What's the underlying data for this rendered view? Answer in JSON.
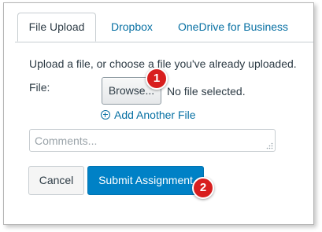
{
  "tabs": [
    {
      "label": "File Upload",
      "active": true
    },
    {
      "label": "Dropbox",
      "active": false
    },
    {
      "label": "OneDrive for Business",
      "active": false
    }
  ],
  "upload": {
    "instructions": "Upload a file, or choose a file you've already uploaded.",
    "file_label": "File:",
    "browse_label": "Browse...",
    "no_file_text": "No file selected.",
    "add_another_label": "Add Another File"
  },
  "comments": {
    "placeholder": "Comments..."
  },
  "actions": {
    "cancel_label": "Cancel",
    "submit_label": "Submit Assignment"
  },
  "callouts": [
    "1",
    "2"
  ],
  "colors": {
    "link": "#0770a3",
    "submit_bg": "#0081c6",
    "badge": "#d81e1e",
    "text": "#2d3b45"
  },
  "icons": {
    "add": "plus-circle-icon",
    "resize": "resize-grip-icon"
  }
}
